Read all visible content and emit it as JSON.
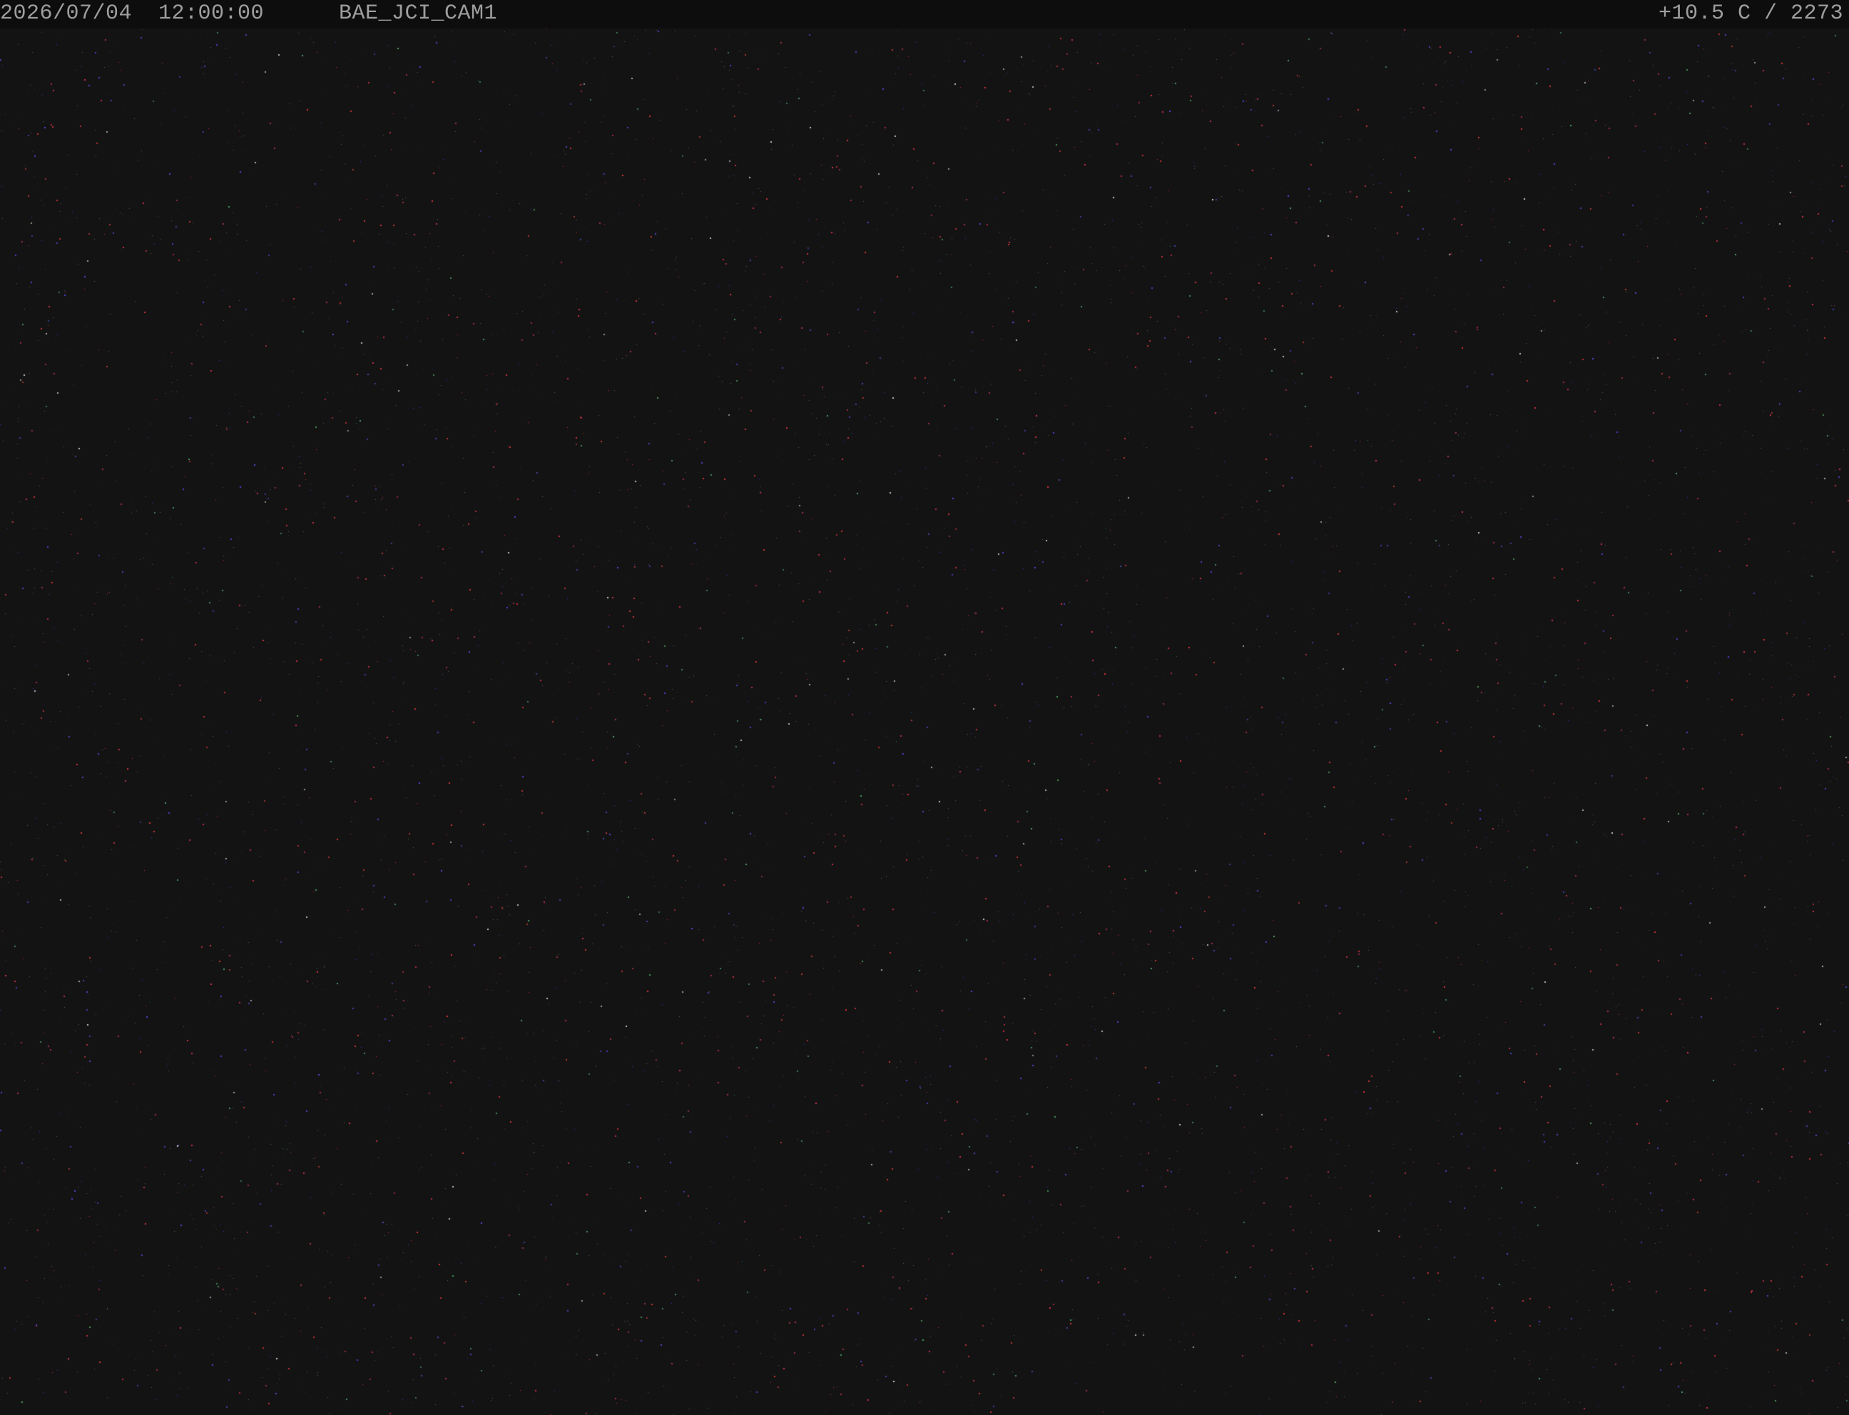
{
  "osd": {
    "datetime": "2026/07/04  12:00:00",
    "camera_name": "BAE_JCI_CAM1",
    "sensor_readout": "+10.5 C / 2273"
  },
  "colors": {
    "background": "#131314",
    "osd_bar": "#0d0d0e",
    "osd_text": "#9e9e9e",
    "noise_red": "#b8303a",
    "noise_blue": "#3a3aa8",
    "noise_green": "#3a7a4a",
    "noise_grey": "#5a5a5a"
  },
  "image": {
    "content": "night-sky camera frame with sensor noise / stars"
  }
}
